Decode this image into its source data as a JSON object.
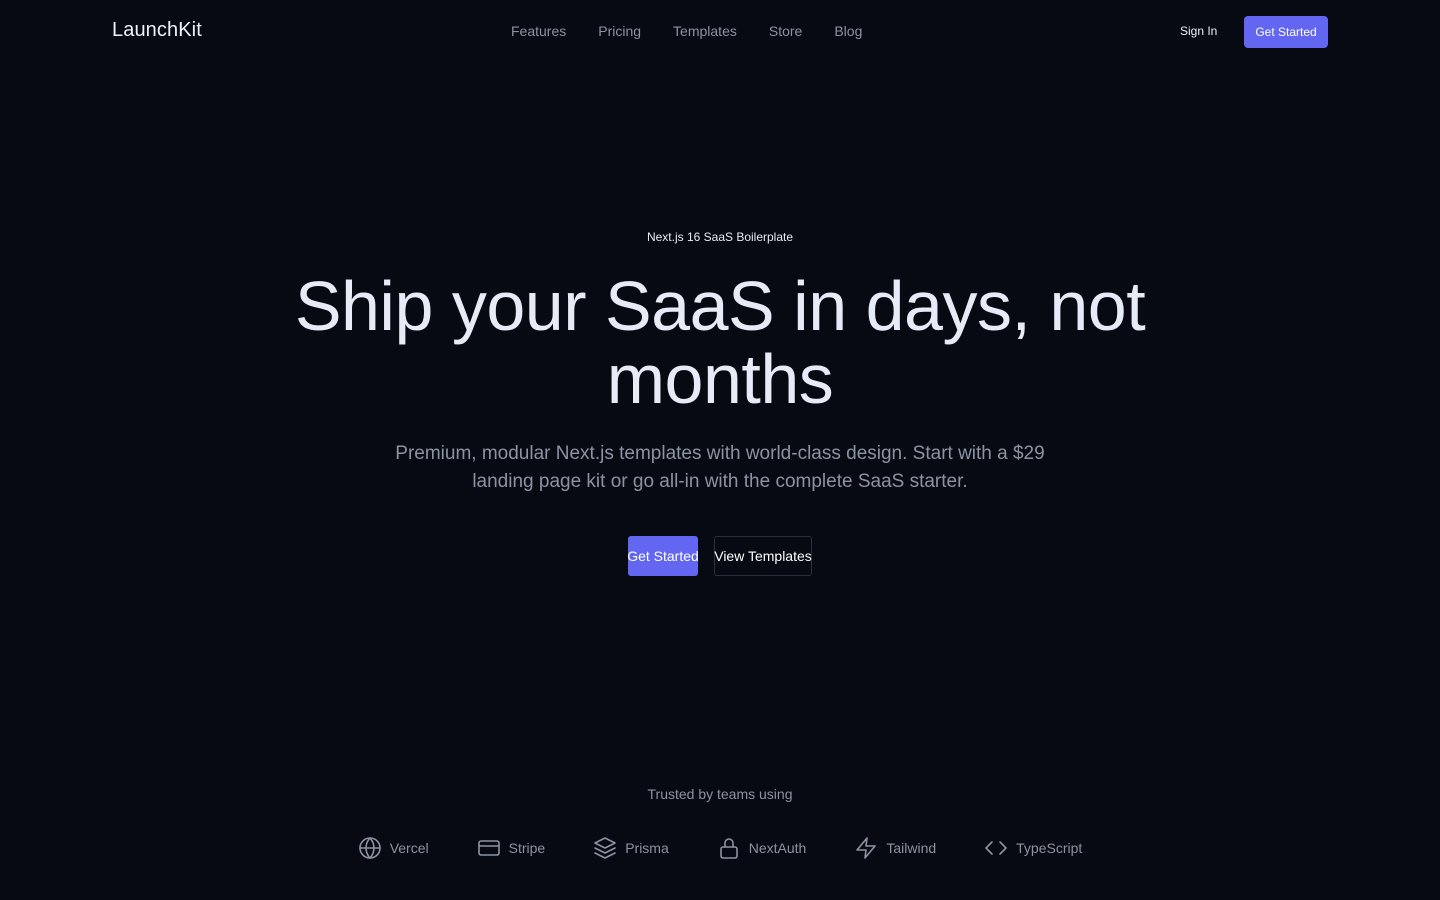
{
  "header": {
    "logo": "LaunchKit",
    "nav": [
      "Features",
      "Pricing",
      "Templates",
      "Store",
      "Blog"
    ],
    "sign_in": "Sign In",
    "cta": "Get Started"
  },
  "hero": {
    "badge": "Next.js 16 SaaS Boilerplate",
    "headline": "Ship your SaaS in days, not months",
    "subhead": "Premium, modular Next.js templates with world-class design. Start with a $29 landing page kit or go all-in with the complete SaaS starter.",
    "primary_cta": "Get Started",
    "secondary_cta": "View Templates"
  },
  "trusted": {
    "label": "Trusted by teams using",
    "logos": [
      {
        "name": "Vercel",
        "icon": "globe-icon"
      },
      {
        "name": "Stripe",
        "icon": "credit-card-icon"
      },
      {
        "name": "Prisma",
        "icon": "layers-icon"
      },
      {
        "name": "NextAuth",
        "icon": "lock-icon"
      },
      {
        "name": "Tailwind",
        "icon": "zap-icon"
      },
      {
        "name": "TypeScript",
        "icon": "code-icon"
      }
    ]
  },
  "colors": {
    "background": "#070a12",
    "accent": "#6366f1",
    "muted_text": "#8c93a3",
    "text": "#e7ebf5"
  }
}
